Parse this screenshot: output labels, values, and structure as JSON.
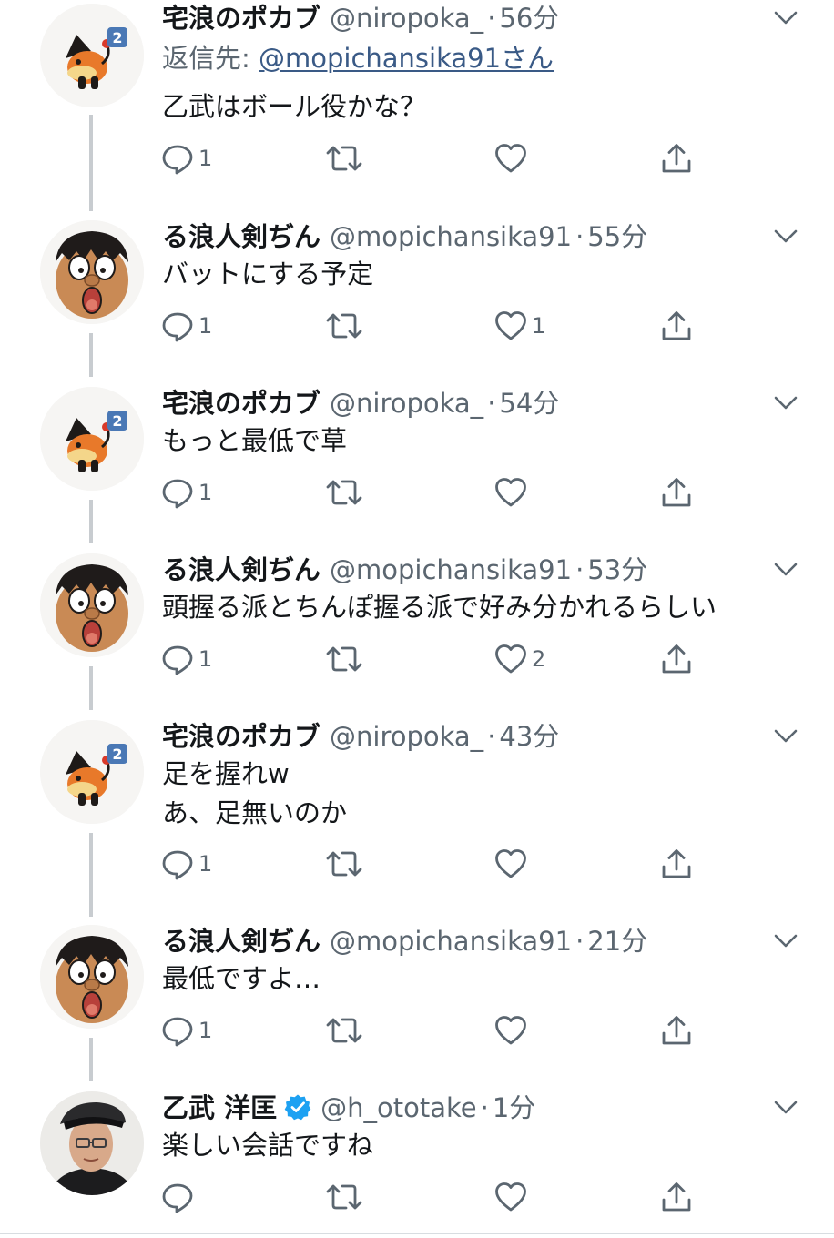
{
  "tweets": [
    {
      "name": "宅浪のポカブ",
      "handle": "@niropoka_",
      "time": "56分",
      "reply_label": "返信先:",
      "reply_to": "@mopichansika91さん",
      "lines": [
        "乙武はボール役かな？"
      ],
      "reply_count": "1",
      "retweet_count": "",
      "like_count": "",
      "avatar": "pokabu-avatar"
    },
    {
      "name": "る浪人剣ぢん",
      "handle": "@mopichansika91",
      "time": "55分",
      "lines": [
        "バットにする予定"
      ],
      "reply_count": "1",
      "retweet_count": "",
      "like_count": "1",
      "avatar": "cartoon-face-avatar"
    },
    {
      "name": "宅浪のポカブ",
      "handle": "@niropoka_",
      "time": "54分",
      "lines": [
        "もっと最低で草"
      ],
      "reply_count": "1",
      "retweet_count": "",
      "like_count": "",
      "avatar": "pokabu-avatar"
    },
    {
      "name": "る浪人剣ぢん",
      "handle": "@mopichansika91",
      "time": "53分",
      "lines": [
        "頭握る派とちんぽ握る派で好み分かれるらしい"
      ],
      "reply_count": "1",
      "retweet_count": "",
      "like_count": "2",
      "avatar": "cartoon-face-avatar"
    },
    {
      "name": "宅浪のポカブ",
      "handle": "@niropoka_",
      "time": "43分",
      "lines": [
        "足を握れw",
        "あ、足無いのか"
      ],
      "reply_count": "1",
      "retweet_count": "",
      "like_count": "",
      "avatar": "pokabu-avatar"
    },
    {
      "name": "る浪人剣ぢん",
      "handle": "@mopichansika91",
      "time": "21分",
      "lines": [
        "最低ですよ…"
      ],
      "reply_count": "1",
      "retweet_count": "",
      "like_count": "",
      "avatar": "cartoon-face-avatar"
    },
    {
      "name": "乙武 洋匡",
      "handle": "@h_ototake",
      "time": "1分",
      "verified": true,
      "lines": [
        "楽しい会話ですね"
      ],
      "reply_count": "",
      "retweet_count": "",
      "like_count": "",
      "avatar": "photo-avatar"
    }
  ],
  "separator": "·",
  "colors": {
    "text": "#14171a",
    "secondary": "#5b6670",
    "thread_line": "#c8ccd0",
    "verified": "#1da1f2",
    "link": "#3a5a86"
  },
  "icons": [
    "reply-icon",
    "retweet-icon",
    "like-icon",
    "share-icon",
    "chevron-down-icon",
    "verified-badge-icon"
  ]
}
